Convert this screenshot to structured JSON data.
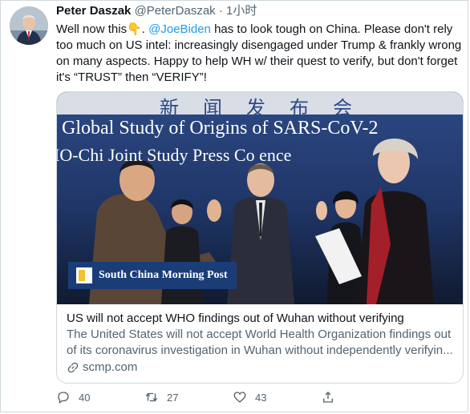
{
  "tweet": {
    "display_name": "Peter Daszak",
    "handle": "@PeterDaszak",
    "separator": "·",
    "time": "1小时",
    "text_before_emoji": "Well now this",
    "emoji": "👇",
    "text_after_emoji": ". ",
    "mention": "@JoeBiden",
    "text_rest": " has to look tough on China. Please don't rely too much on US intel: increasingly disengaged under Trump & frankly wrong on many aspects. Happy to help WH w/ their quest to verify, but don't forget it's “TRUST” then “VERIFY”!"
  },
  "card": {
    "image": {
      "banner_top": "新 闻 发 布 会",
      "banner_line1": "Global Study of Origins of SARS-CoV-2",
      "banner_line2": "IO-Chi     Joint Study Press Co      ence",
      "logo_text": "South China Morning Post"
    },
    "title": "US will not accept WHO findings out of Wuhan without verifying",
    "description": "The United States will not accept World Health Organization findings out of its coronavirus investigation in Wuhan without independently verifyin...",
    "domain": "scmp.com"
  },
  "actions": {
    "reply_count": "40",
    "retweet_count": "27",
    "like_count": "43"
  },
  "colors": {
    "accent": "#1d9bf0",
    "secondary_text": "#536471",
    "border": "#cfd9de"
  }
}
